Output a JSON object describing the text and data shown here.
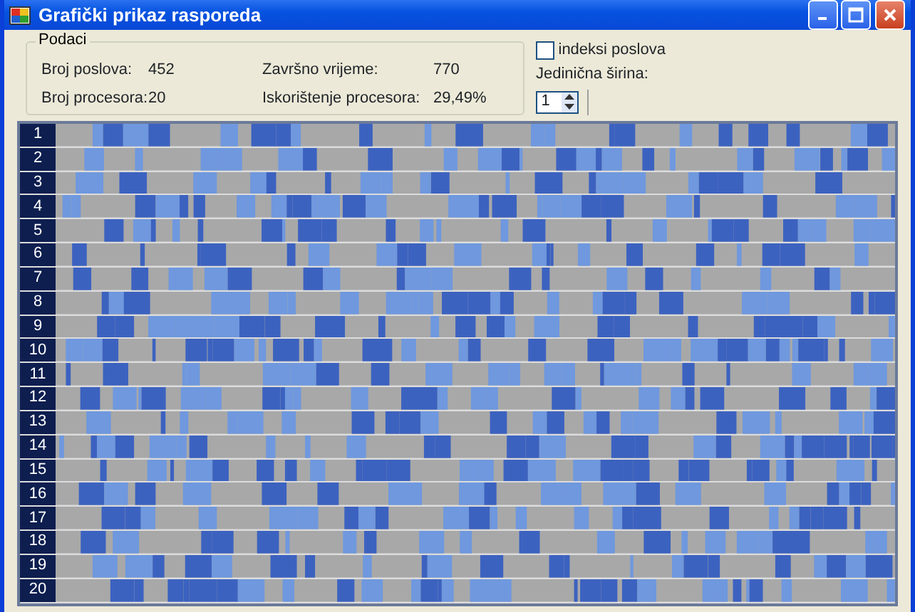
{
  "window": {
    "title": "Grafički prikaz rasporeda"
  },
  "data_group": {
    "title": "Podaci",
    "fields": [
      {
        "label": "Broj poslova:",
        "value": "452"
      },
      {
        "label": "Završno vrijeme:",
        "value": "770"
      },
      {
        "label": "Broj procesora:",
        "value": "20"
      },
      {
        "label": "Iskorištenje procesora:",
        "value": "29,49%"
      }
    ]
  },
  "job_index_checkbox": {
    "label": "indeksi poslova",
    "checked": false
  },
  "unit_width": {
    "label": "Jedinična širina:",
    "value": "1"
  },
  "schedule": {
    "rows": [
      {
        "label": "1"
      },
      {
        "label": "2"
      },
      {
        "label": "3"
      },
      {
        "label": "4"
      },
      {
        "label": "5"
      },
      {
        "label": "6"
      },
      {
        "label": "7"
      },
      {
        "label": "8"
      },
      {
        "label": "9"
      },
      {
        "label": "10"
      },
      {
        "label": "11"
      },
      {
        "label": "12"
      },
      {
        "label": "13"
      },
      {
        "label": "14"
      },
      {
        "label": "15"
      },
      {
        "label": "16"
      },
      {
        "label": "17"
      },
      {
        "label": "18"
      },
      {
        "label": "19"
      },
      {
        "label": "20"
      }
    ]
  }
}
